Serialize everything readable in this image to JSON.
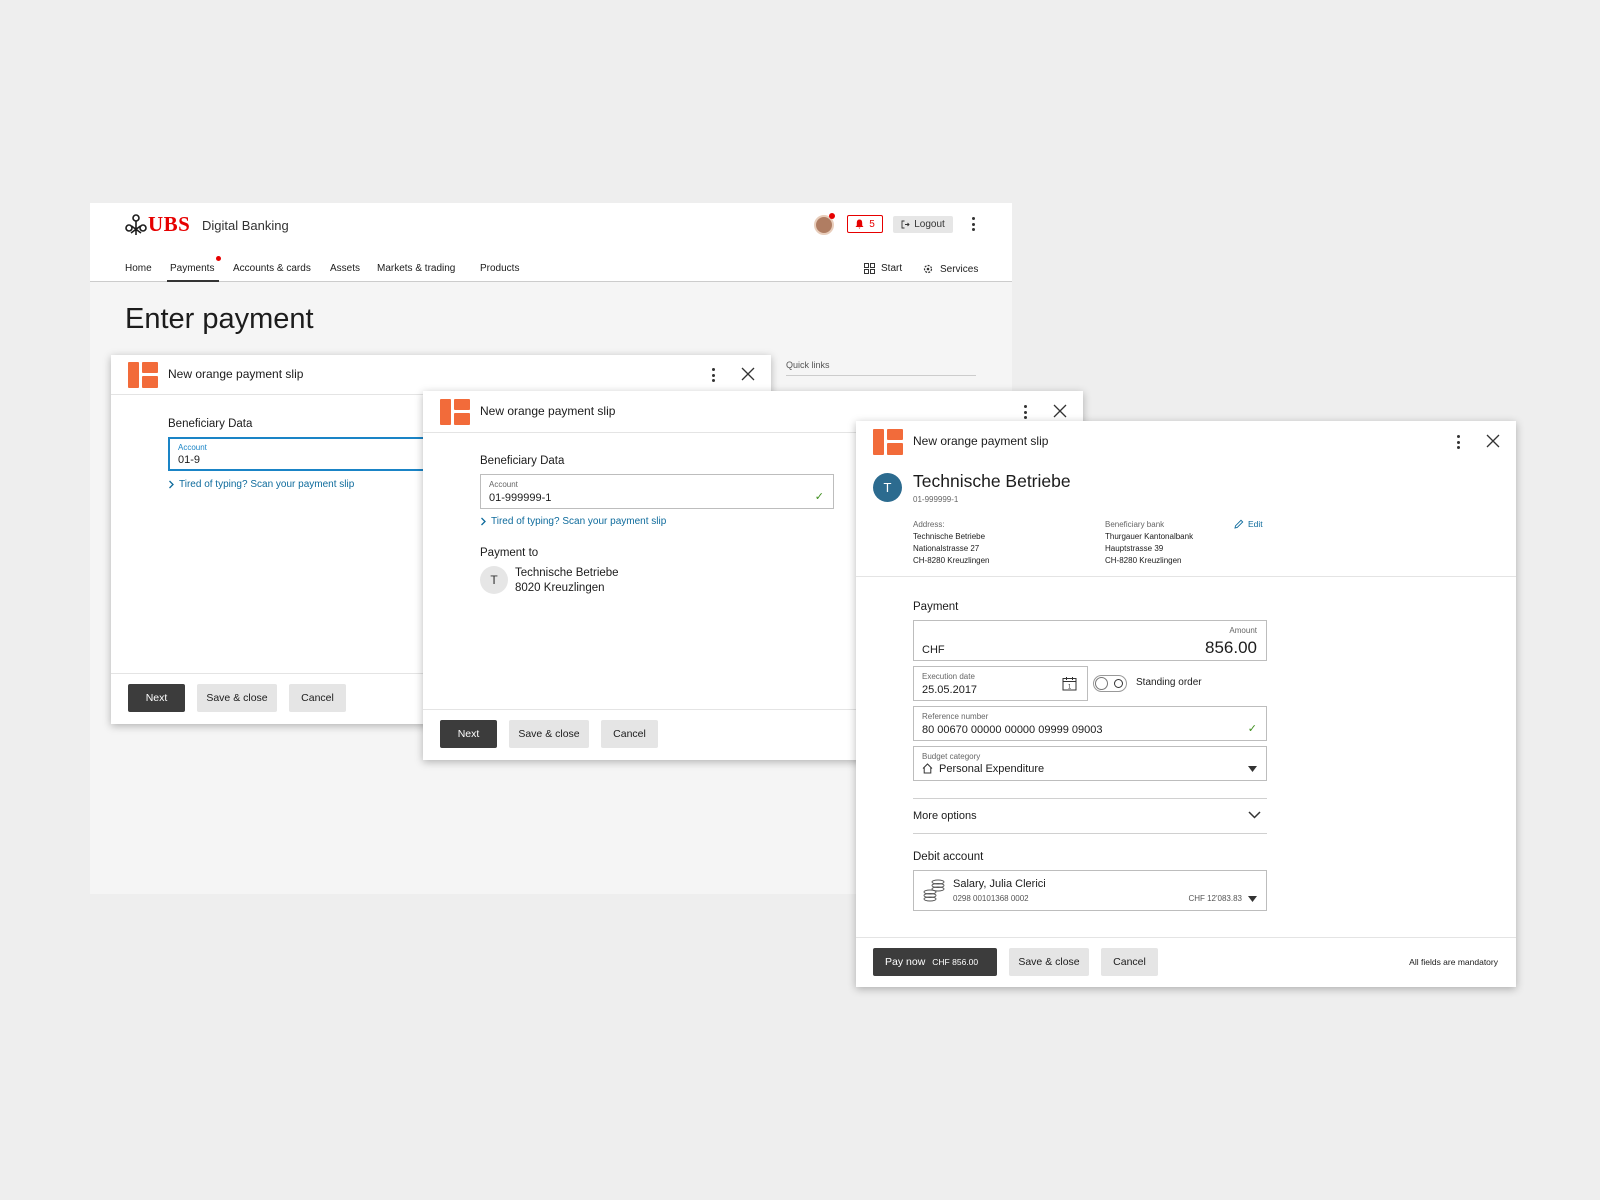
{
  "header": {
    "brand": "UBS",
    "app_title": "Digital Banking",
    "notifications_count": "5",
    "logout_label": "Logout"
  },
  "nav": {
    "items": [
      "Home",
      "Payments",
      "Accounts & cards",
      "Assets",
      "Markets & trading",
      "Products"
    ],
    "active": "Payments",
    "right": [
      "Start",
      "Services"
    ]
  },
  "page": {
    "title": "Enter payment",
    "quick_links": "Quick links"
  },
  "panel1": {
    "title": "New orange payment slip",
    "section": "Beneficiary Data",
    "account_label": "Account",
    "account_value": "01-9",
    "scan_link": "Tired of typing? Scan your payment slip",
    "buttons": {
      "next": "Next",
      "save": "Save & close",
      "cancel": "Cancel"
    }
  },
  "panel2": {
    "title": "New orange payment slip",
    "section": "Beneficiary Data",
    "account_label": "Account",
    "account_value": "01-999999-1",
    "scan_link": "Tired of typing? Scan your payment slip",
    "payment_to_label": "Payment to",
    "payee_initial": "T",
    "payee_name": "Technische Betriebe",
    "payee_city": "8020 Kreuzlingen",
    "buttons": {
      "next": "Next",
      "save": "Save & close",
      "cancel": "Cancel"
    }
  },
  "panel3": {
    "title": "New orange payment slip",
    "beneficiary": {
      "initial": "T",
      "name": "Technische Betriebe",
      "account": "01-999999-1",
      "address_label": "Address:",
      "address_lines": [
        "Technische Betriebe",
        "Nationalstrasse 27",
        "CH-8280 Kreuzlingen"
      ],
      "bank_label": "Beneficiary bank",
      "bank_lines": [
        "Thurgauer Kantonalbank",
        "Hauptstrasse 39",
        "CH-8280 Kreuzlingen"
      ],
      "edit_label": "Edit"
    },
    "payment": {
      "section": "Payment",
      "currency": "CHF",
      "amount_label": "Amount",
      "amount": "856.00",
      "execution_label": "Execution date",
      "execution_date": "25.05.2017",
      "standing_order_label": "Standing order",
      "reference_label": "Reference number",
      "reference": "80 00670 00000 00000 09999 09003",
      "budget_label": "Budget category",
      "budget": "Personal Expenditure",
      "more_options": "More options"
    },
    "debit": {
      "section": "Debit account",
      "account_name": "Salary, Julia Clerici",
      "account_number": "0298 00101368 0002",
      "balance": "CHF 12'083.83"
    },
    "footer": {
      "pay_now": "Pay now",
      "pay_amount": "CHF 856.00",
      "save": "Save & close",
      "cancel": "Cancel",
      "mandatory": "All fields are mandatory"
    }
  },
  "colors": {
    "brand_red": "#e60000",
    "slip_orange": "#f26b3a",
    "link_blue": "#0e6b9c",
    "dark_button": "#3c3c3c",
    "avatar_teal": "#2c6b8f"
  }
}
